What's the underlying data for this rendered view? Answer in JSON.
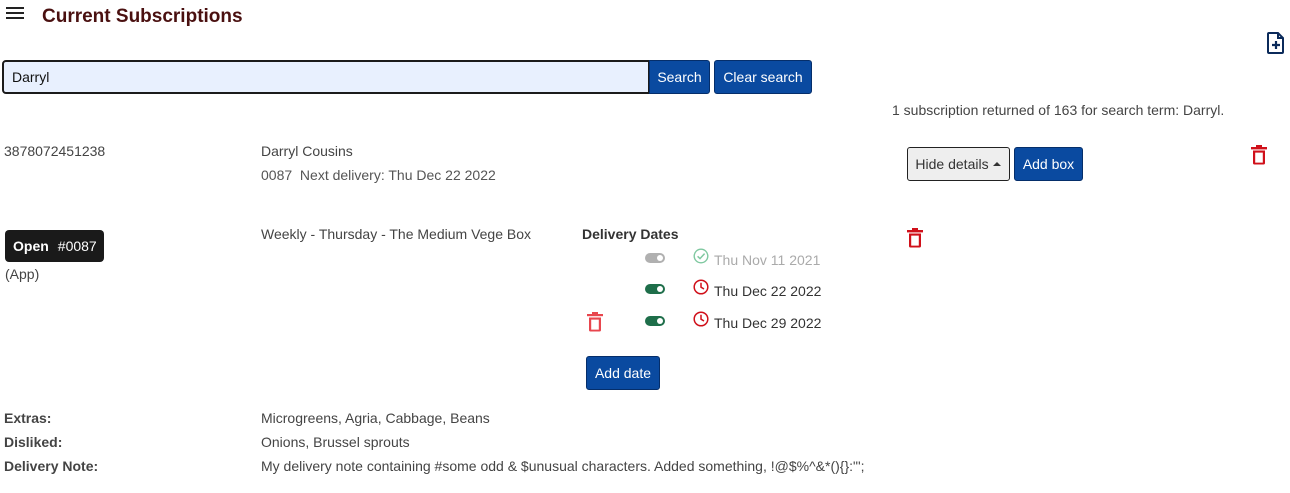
{
  "header": {
    "title": "Current Subscriptions",
    "menu_icon": "hamburger-menu-icon",
    "new_icon": "file-plus-icon"
  },
  "search": {
    "value": "Darryl",
    "search_label": "Search",
    "clear_label": "Clear search",
    "result_text": "1 subscription returned of 163 for search term: Darryl."
  },
  "subscription": {
    "id": "3878072451238",
    "customer_name": "Darryl Cousins",
    "next_delivery": "0087  Next delivery: Thu Dec 22 2022",
    "hide_details_label": "Hide details",
    "add_box_label": "Add box",
    "status": "Open",
    "order_number": "#0087",
    "source": "(App)",
    "box_description": "Weekly - Thursday - The Medium Vege Box",
    "delivery_dates_heading": "Delivery Dates",
    "delivery_dates": [
      {
        "date": "Thu Nov 11 2021",
        "state": "delivered",
        "toggle": "off"
      },
      {
        "date": "Thu Dec 22 2022",
        "state": "pending",
        "toggle": "on"
      },
      {
        "date": "Thu Dec 29 2022",
        "state": "pending",
        "toggle": "on"
      }
    ],
    "add_date_label": "Add date",
    "extras_label": "Extras:",
    "extras_value": "Microgreens, Agria, Cabbage, Beans",
    "disliked_label": "Disliked:",
    "disliked_value": "Onions, Brussel sprouts",
    "note_label": "Delivery Note:",
    "note_value": "My delivery note containing #some odd & $unusual characters. Added something, !@$%^&*(){}:\"';"
  },
  "colors": {
    "title": "#4a1010",
    "primary_button": "#0a4aa0",
    "danger_icon": "#d0101a",
    "toggle_on": "#1e6e4a",
    "check_icon": "#7fc8a0"
  }
}
